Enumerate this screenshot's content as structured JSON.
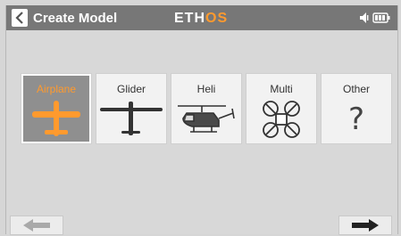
{
  "header": {
    "title": "Create Model",
    "logo_main": "ETH",
    "logo_accent": "OS",
    "back_icon": "chevron-left-icon",
    "status_icons": [
      "speaker-icon",
      "battery-icon"
    ]
  },
  "model_types": [
    {
      "label": "Airplane",
      "icon": "airplane-icon",
      "selected": true
    },
    {
      "label": "Glider",
      "icon": "glider-icon",
      "selected": false
    },
    {
      "label": "Heli",
      "icon": "helicopter-icon",
      "selected": false
    },
    {
      "label": "Multi",
      "icon": "quadcopter-icon",
      "selected": false
    },
    {
      "label": "Other",
      "icon": "question-mark-icon",
      "glyph": "?",
      "selected": false
    }
  ],
  "navigation": {
    "prev_icon": "arrow-left-icon",
    "next_icon": "arrow-right-icon"
  },
  "colors": {
    "accent": "#ff9a2e",
    "header_bg": "#777777",
    "selected_tile_bg": "#8f8f8f"
  }
}
